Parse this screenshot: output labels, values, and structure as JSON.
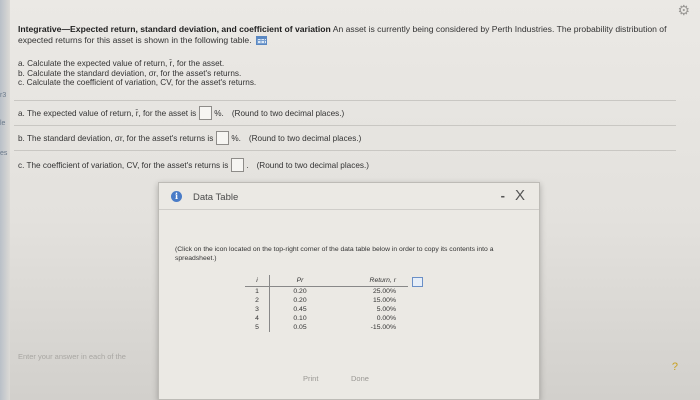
{
  "page": {
    "title_bold": "Integrative—Expected return, standard    deviation, and coefficient of variation",
    "title_rest": "An asset is currently being considered by Perth Industries. The probability distribution of expected returns for this asset is shown in the following table.",
    "tasks": [
      "a. Calculate the expected value of return, r̄, for the asset.",
      "b. Calculate the standard deviation, σr, for the asset's returns.",
      "c. Calculate the coefficient of variation, CV, for the asset's returns."
    ],
    "questions": [
      {
        "prefix": "a. The expected value of return, r̄, for the asset is",
        "suffix": "%.",
        "hint": "(Round to two decimal places.)"
      },
      {
        "prefix": "b. The standard deviation, σr, for the asset's returns is",
        "suffix": "%.",
        "hint": "(Round to two decimal places.)"
      },
      {
        "prefix": "c. The coefficient of variation, CV, for the asset's returns is",
        "suffix": ".",
        "hint": "(Round to two decimal places.)"
      }
    ],
    "enter_note": "Enter your answer in each of the",
    "help": "?"
  },
  "dialog": {
    "title": "Data Table",
    "minimize": "-",
    "close": "X",
    "instructions": "(Click on the icon located on the top-right corner of the data table below in order to copy its contents into a spreadsheet.)",
    "columns": [
      "i",
      "Pr",
      "Return, r"
    ],
    "rows": [
      [
        "1",
        "0.20",
        "25.00%"
      ],
      [
        "2",
        "0.20",
        "15.00%"
      ],
      [
        "3",
        "0.45",
        "5.00%"
      ],
      [
        "4",
        "0.10",
        "0.00%"
      ],
      [
        "5",
        "0.05",
        "-15.00%"
      ]
    ],
    "print_label": "Print",
    "done_label": "Done"
  },
  "icons": [
    "gear-icon",
    "table-icon",
    "info-icon",
    "copy-icon",
    "help-icon"
  ],
  "colors": {
    "accent": "#4a7cc7",
    "help": "#c9a11f"
  }
}
